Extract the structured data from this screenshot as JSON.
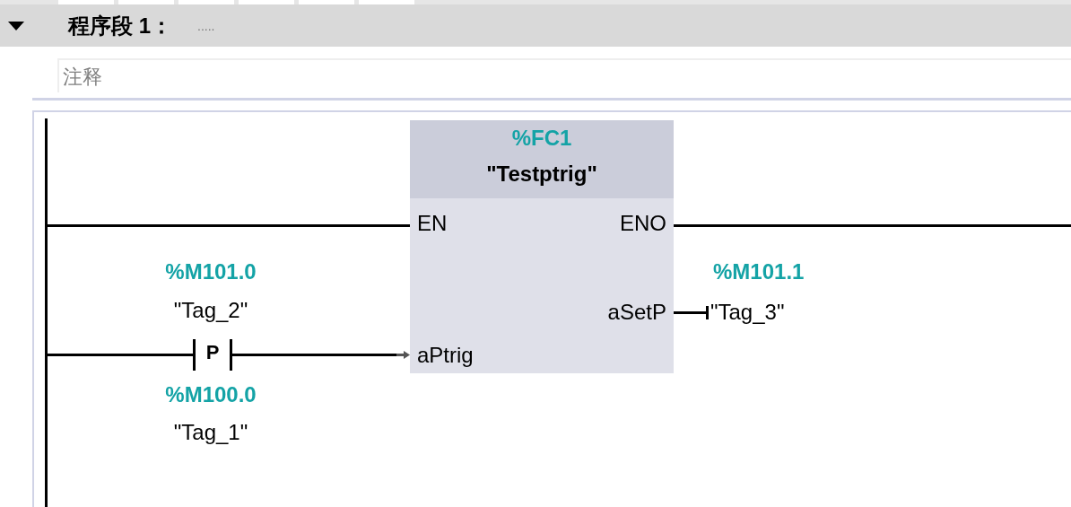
{
  "network": {
    "title": "程序段 1：",
    "comment_title": ".....",
    "expanded": true
  },
  "comment": {
    "placeholder": "注释"
  },
  "block": {
    "address": "%FC1",
    "name": "\"Testptrig\"",
    "inputs": [
      {
        "pin": "EN"
      },
      {
        "pin": "aPtrig"
      }
    ],
    "outputs": [
      {
        "pin": "ENO"
      },
      {
        "pin": "aSetP"
      }
    ]
  },
  "contact": {
    "kind": "positive-edge",
    "symbol": "P",
    "address": "%M101.0",
    "tag": "\"Tag_2\"",
    "edge_address": "%M100.0",
    "edge_tag": "\"Tag_1\""
  },
  "coil_output": {
    "address": "%M101.1",
    "tag": "\"Tag_3\""
  }
}
